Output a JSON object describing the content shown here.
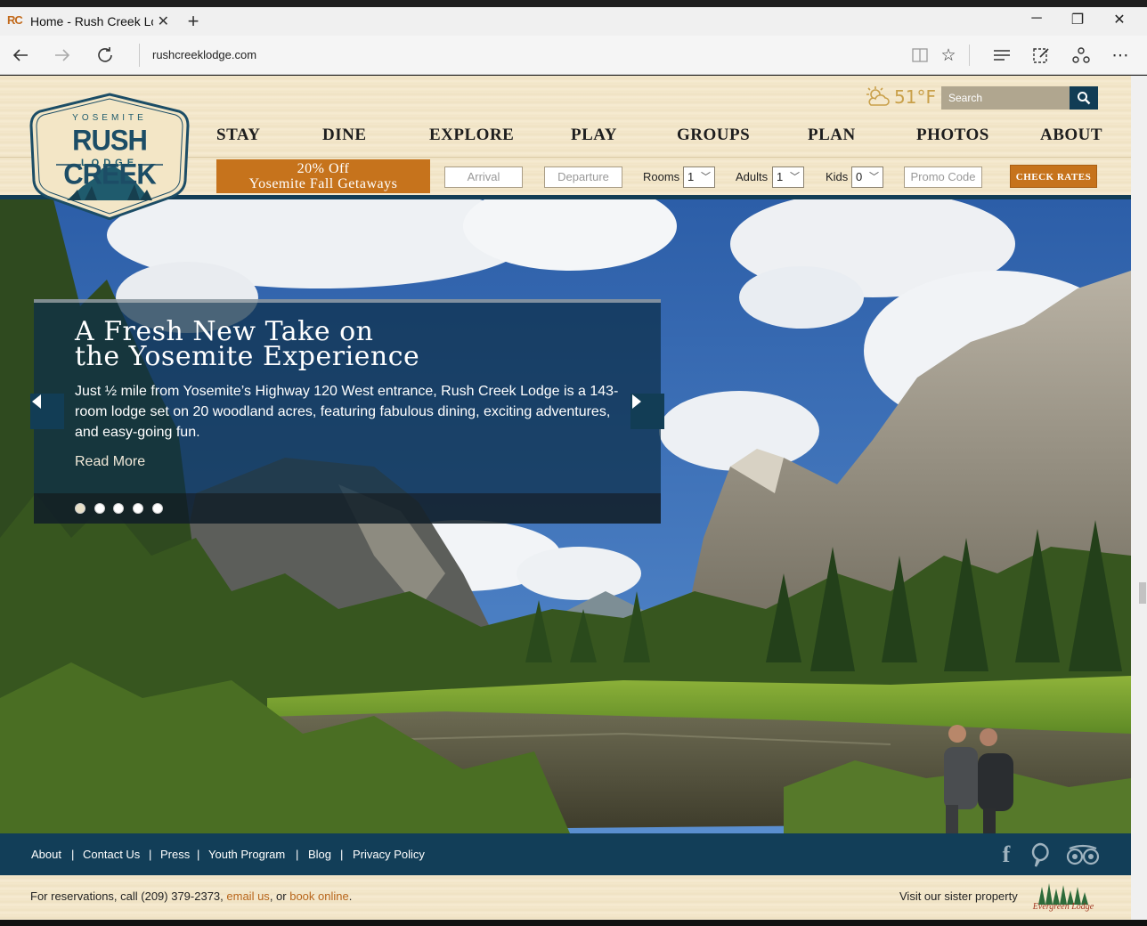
{
  "browser": {
    "tab_favicon": "RC",
    "tab_title": "Home - Rush Creek Lod",
    "url": "rushcreeklodge.com",
    "icons": [
      "back-icon",
      "forward-icon",
      "refresh-icon",
      "reading-view-icon",
      "favorite-star-icon",
      "hub-icon",
      "web-note-icon",
      "share-icon",
      "more-icon"
    ]
  },
  "header": {
    "logo": {
      "top": "YOSEMITE",
      "main": "RUSH CREEK",
      "sub": "LODGE"
    },
    "weather": {
      "temp": "51°F",
      "icon": "partly-sunny-icon"
    },
    "search_placeholder": "Search",
    "nav": [
      "STAY",
      "DINE",
      "EXPLORE",
      "PLAY",
      "GROUPS",
      "PLAN",
      "PHOTOS",
      "ABOUT"
    ],
    "promo_line1": "20% Off",
    "promo_line2": "Yosemite Fall Getaways",
    "booking": {
      "arrival_placeholder": "Arrival",
      "departure_placeholder": "Departure",
      "rooms_label": "Rooms",
      "rooms_value": "1",
      "adults_label": "Adults",
      "adults_value": "1",
      "kids_label": "Kids",
      "kids_value": "0",
      "promo_placeholder": "Promo Code",
      "check_rates": "CHECK RATES"
    },
    "accent_color": "#c6731c",
    "brand_color": "#123d55"
  },
  "hero": {
    "title_line1": "A Fresh New Take on",
    "title_line2": "the Yosemite Experience",
    "text": "Just ½ mile from Yosemite’s Highway 120 West entrance, Rush Creek Lodge is a 143-room lodge set on 20 woodland acres, featuring fabulous dining, exciting adventures, and easy-going fun.",
    "link": "Read More",
    "slide_count": 5,
    "active_slide": 1
  },
  "footer": {
    "links": [
      "About",
      "Contact Us",
      "Press",
      "Youth Program",
      "Blog",
      "Privacy Policy"
    ],
    "separator": "|",
    "social": [
      "facebook-icon",
      "pinterest-icon",
      "tripadvisor-icon"
    ],
    "res_prefix": "For reservations, call (209) 379-2373, ",
    "res_email": "email us",
    "res_mid": ", or ",
    "res_book": "book online",
    "res_end": ".",
    "sister_text": "Visit our sister property",
    "sister_logo_text": "Evergreen Lodge"
  }
}
